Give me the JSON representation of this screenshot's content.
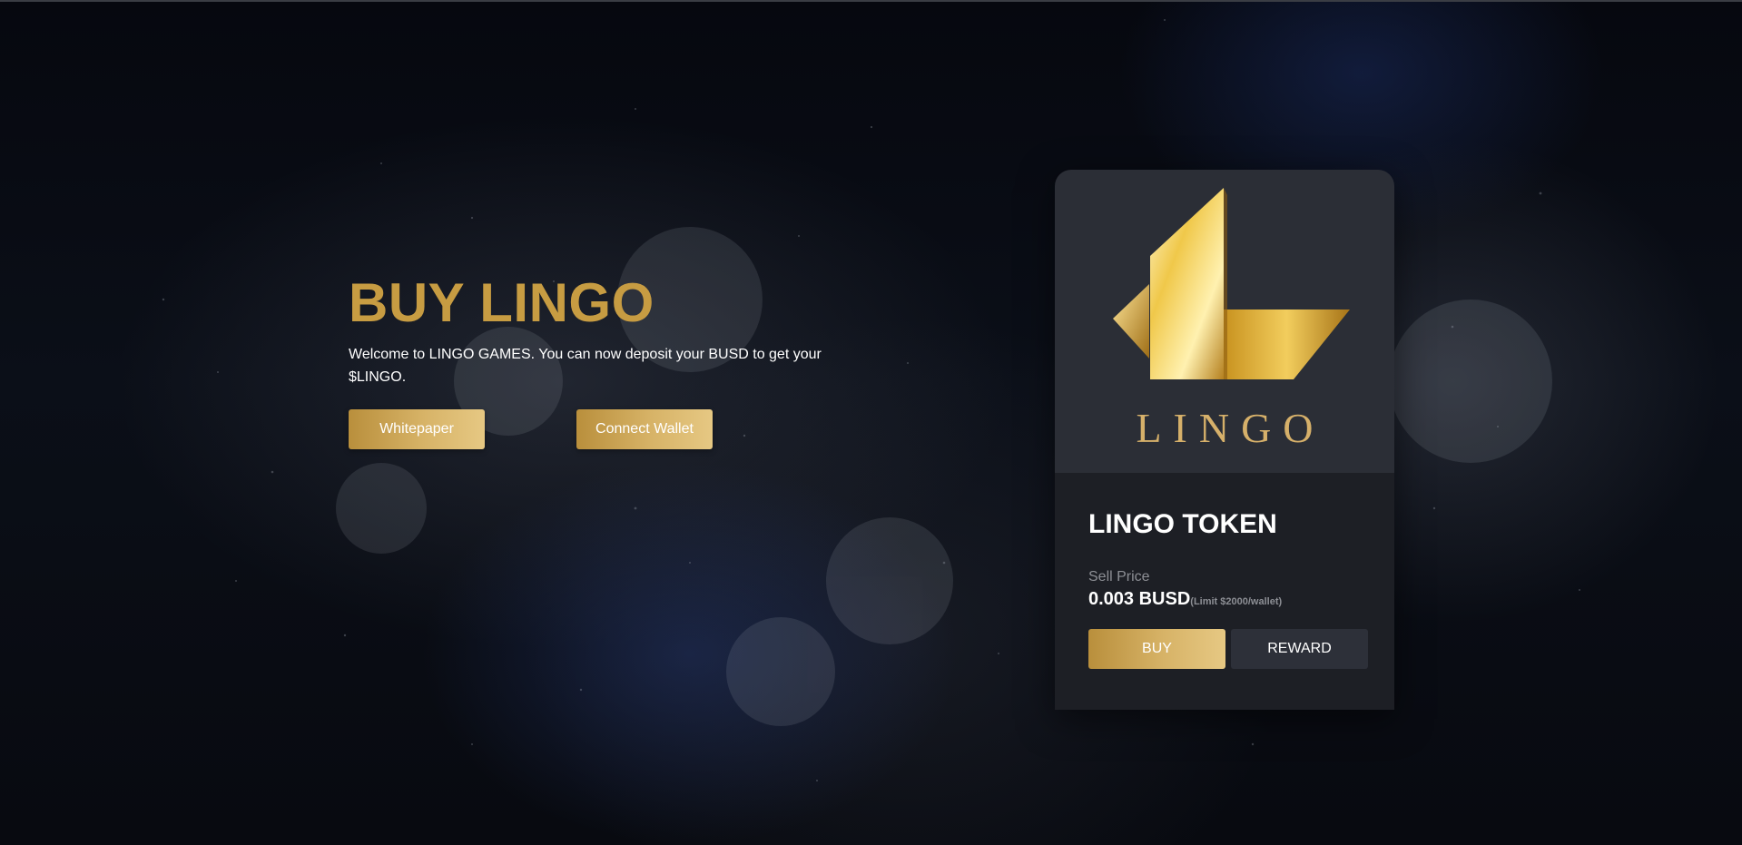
{
  "hero": {
    "title": "BUY LINGO",
    "description": "Welcome to LINGO GAMES. You can now deposit your BUSD to get your $LINGO.",
    "whitepaper_label": "Whitepaper",
    "connect_wallet_label": "Connect Wallet"
  },
  "token_card": {
    "logo_text": "LINGO",
    "title": "LINGO TOKEN",
    "sell_price_label": "Sell Price",
    "price": "0.003 BUSD",
    "limit": "(Limit $2000/wallet)",
    "buy_label": "BUY",
    "reward_label": "REWARD"
  },
  "colors": {
    "gold": "#c79c42",
    "card_top": "#2b2e36",
    "card_bottom": "#1d1f25"
  }
}
